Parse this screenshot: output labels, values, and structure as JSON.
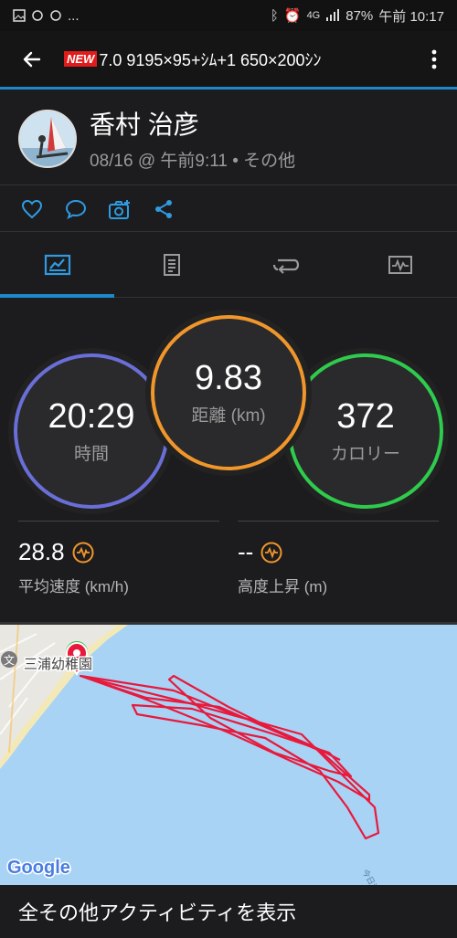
{
  "status_bar": {
    "dots": "...",
    "battery": "87%",
    "time": "午前 10:17",
    "signal": "4G"
  },
  "app_bar": {
    "badge": "NEW",
    "title": "7.0 9195×95+ｼﾑ+1 650×200ｼﾝ"
  },
  "profile": {
    "name": "香村 治彦",
    "meta": "08/16 @ 午前9:11 • その他"
  },
  "stats": {
    "time": {
      "value": "20:29",
      "label": "時間",
      "color": "#6a6fd8"
    },
    "distance": {
      "value": "9.83",
      "label": "距離 (km)",
      "color": "#f0962b"
    },
    "calories": {
      "value": "372",
      "label": "カロリー",
      "color": "#2ecb4d"
    },
    "avg_speed": {
      "value": "28.8",
      "label": "平均速度 (km/h)"
    },
    "elevation": {
      "value": "--",
      "label": "高度上昇 (m)"
    }
  },
  "map": {
    "place_label": "三浦幼稚園",
    "sea_label": "今日津",
    "attribution": "Google",
    "route_color": "#e8193c",
    "water_color": "#a8d3f5"
  },
  "footer": {
    "label": "全その他アクティビティを表示"
  },
  "colors": {
    "accent": "#1e88c9",
    "background": "#1c1c1e"
  }
}
